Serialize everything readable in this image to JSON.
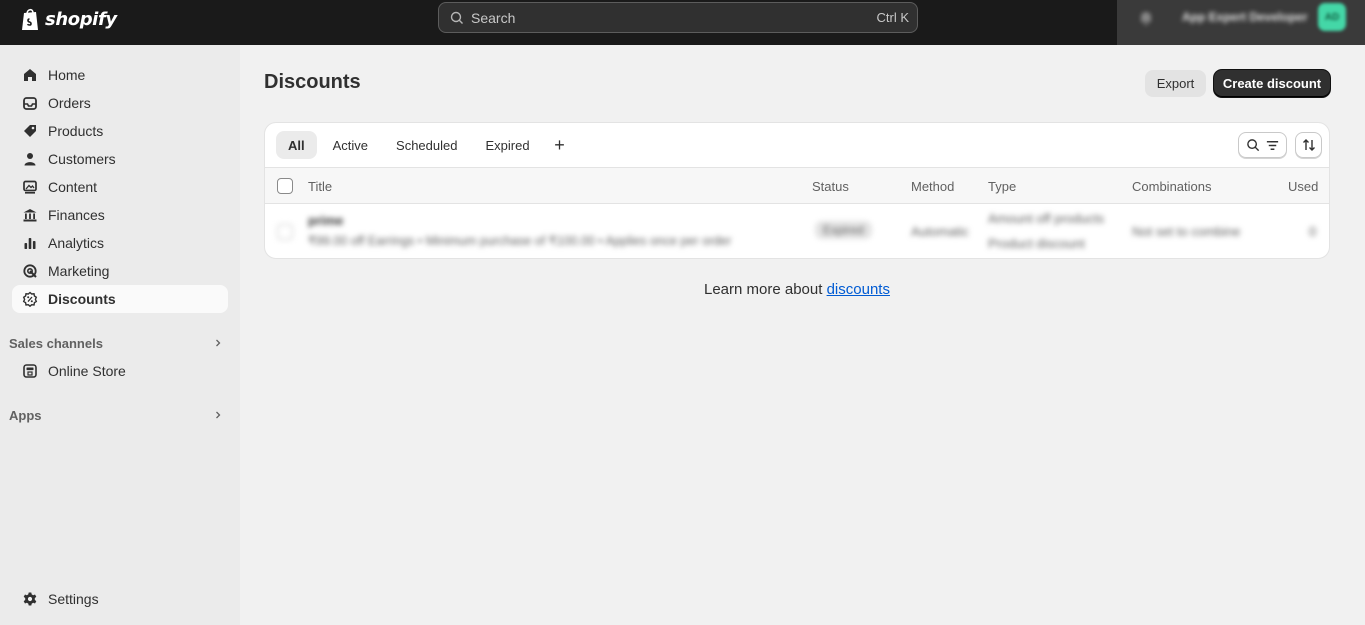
{
  "topbar": {
    "logo_text": "shopify",
    "search_placeholder": "Search",
    "search_shortcut": "Ctrl K",
    "store_name": "App Expert Developer",
    "store_initials": "AD"
  },
  "sidebar": {
    "items": [
      {
        "label": "Home",
        "icon": "home-icon"
      },
      {
        "label": "Orders",
        "icon": "orders-icon"
      },
      {
        "label": "Products",
        "icon": "tag-icon"
      },
      {
        "label": "Customers",
        "icon": "person-icon"
      },
      {
        "label": "Content",
        "icon": "content-icon"
      },
      {
        "label": "Finances",
        "icon": "bank-icon"
      },
      {
        "label": "Analytics",
        "icon": "bar-chart-icon"
      },
      {
        "label": "Marketing",
        "icon": "target-icon"
      },
      {
        "label": "Discounts",
        "icon": "discount-icon",
        "active": true
      }
    ],
    "sales_channels_label": "Sales channels",
    "online_store_label": "Online Store",
    "apps_label": "Apps",
    "settings_label": "Settings"
  },
  "page": {
    "title": "Discounts",
    "export_label": "Export",
    "create_label": "Create discount",
    "tabs": [
      "All",
      "Active",
      "Scheduled",
      "Expired"
    ],
    "active_tab": "All",
    "add_tab_label": "+"
  },
  "table": {
    "columns": [
      "Title",
      "Status",
      "Method",
      "Type",
      "Combinations",
      "Used"
    ],
    "rows": [
      {
        "title": "prime",
        "summary": "₹99.00 off Earrings • Minimum purchase of ₹100.00 • Applies once per order",
        "status": "Expired",
        "method": "Automatic",
        "type_line1": "Amount off products",
        "type_line2": "Product discount",
        "combinations": "Not set to combine",
        "used": "0"
      }
    ]
  },
  "footer": {
    "learn_prefix": "Learn more about ",
    "learn_link": "discounts"
  },
  "colors": {
    "topbar_bg": "#1a1a1a",
    "primary_button": "#303030",
    "link": "#005bd3",
    "avatar": "#44d7a7"
  }
}
